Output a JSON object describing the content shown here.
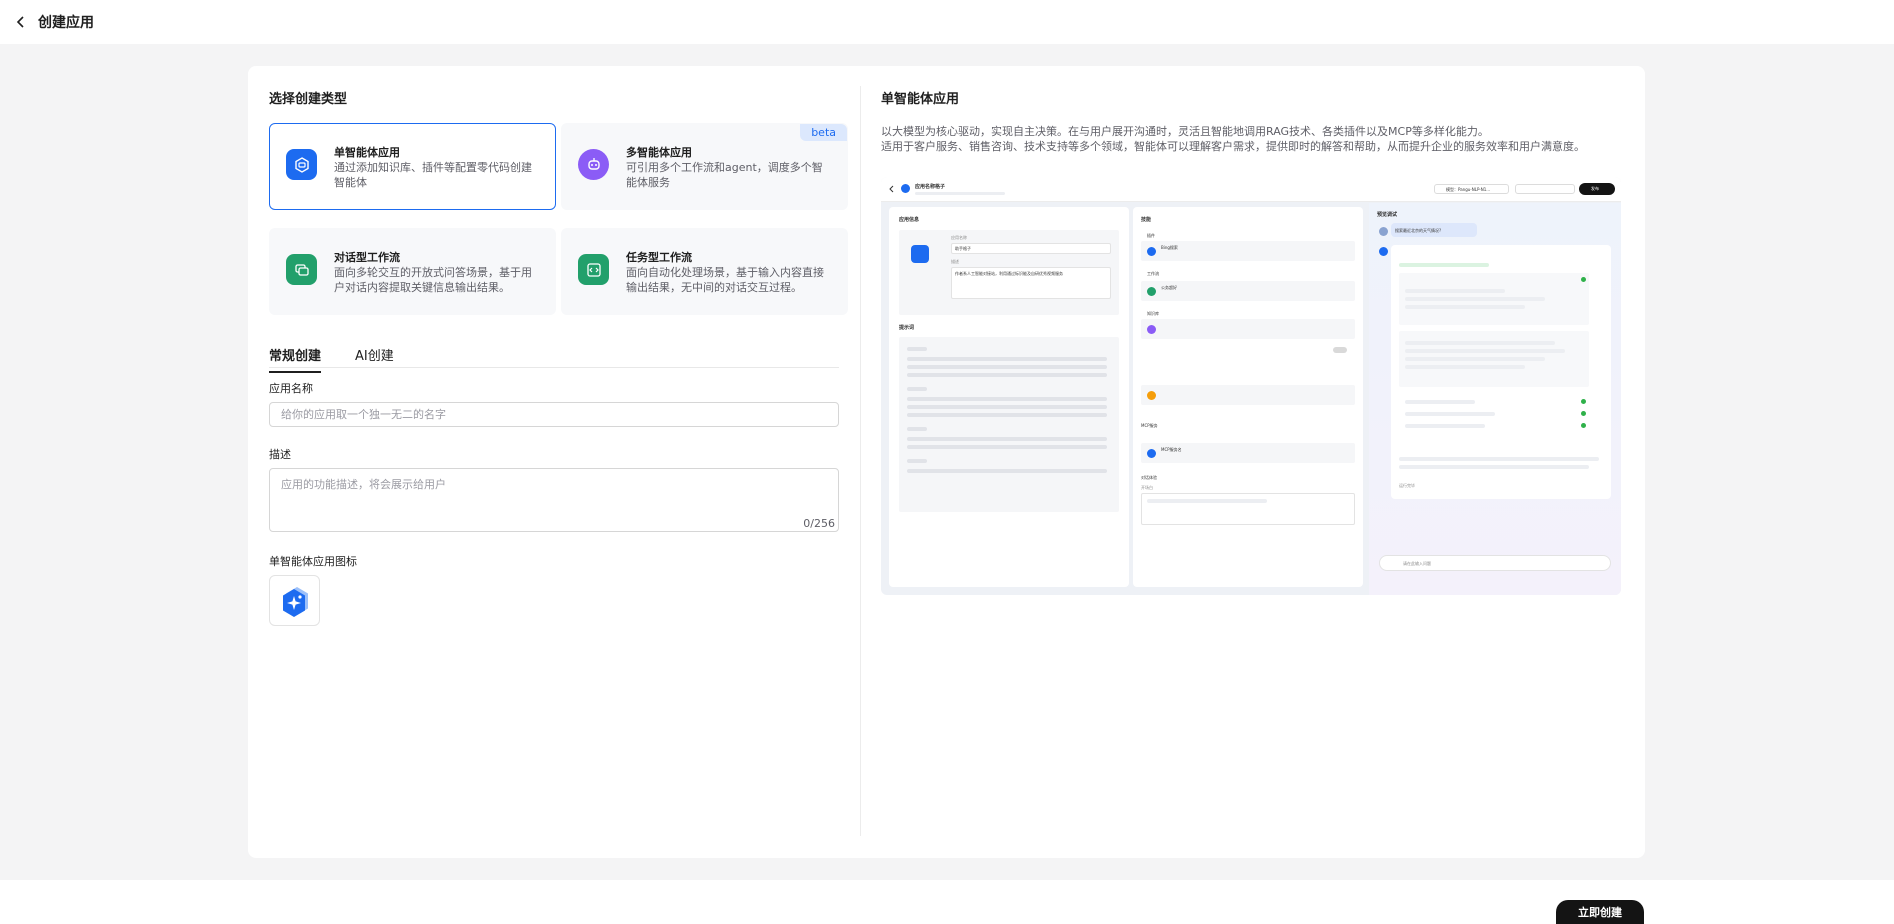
{
  "header": {
    "title": "创建应用"
  },
  "left": {
    "section_title": "选择创建类型",
    "types": [
      {
        "title": "单智能体应用",
        "desc": "通过添加知识库、插件等配置零代码创建智能体",
        "icon": "single-agent-icon",
        "color": "#1d6bf0",
        "selected": true
      },
      {
        "title": "多智能体应用",
        "desc": "可引用多个工作流和agent，调度多个智能体服务",
        "icon": "multi-agent-icon",
        "color": "#8b5cf6",
        "badge": "beta"
      },
      {
        "title": "对话型工作流",
        "desc": "面向多轮交互的开放式问答场景，基于用户对话内容提取关键信息输出结果。",
        "icon": "chat-workflow-icon",
        "color": "#22a06b"
      },
      {
        "title": "任务型工作流",
        "desc": "面向自动化处理场景，基于输入内容直接输出结果，无中间的对话交互过程。",
        "icon": "task-workflow-icon",
        "color": "#22a06b"
      }
    ],
    "tabs": [
      {
        "label": "常规创建",
        "active": true
      },
      {
        "label": "AI创建"
      }
    ],
    "name_label": "应用名称",
    "name_placeholder": "给你的应用取一个独一无二的名字",
    "desc_label": "描述",
    "desc_placeholder": "应用的功能描述，将会展示给用户",
    "desc_counter": "0/256",
    "icon_label": "单智能体应用图标"
  },
  "right": {
    "title": "单智能体应用",
    "desc_line1": "以大模型为核心驱动，实现自主决策。在与用户展开沟通时，灵活且智能地调用RAG技术、各类插件以及MCP等多样化能力。",
    "desc_line2": "适用于客户服务、销售咨询、技术支持等多个领域，智能体可以理解客户需求，提供即时的解答和帮助，从而提升企业的服务效率和用户满意度。",
    "preview": {
      "app_name": "应用名称格子",
      "model_label": "模型：Pangu-NLP-N1...",
      "publish": "发布",
      "col1_title": "应用信息",
      "app_name_label": "应用名称",
      "app_name_value": "助手格子",
      "desc_label": "描述",
      "desc_value": "作者系人工智能对接站，利用通过标识能及自研优秀视频服务",
      "prompt_title": "提示词",
      "col2_title": "技能",
      "plugins": "插件",
      "plugin_name": "Bing搜索",
      "workflow": "工作流",
      "workflow_name": "公务超好",
      "knowledge": "知识库",
      "mcp": "MCP服务",
      "mcp_name": "MCP服务名",
      "dialog": "对话体验",
      "opening": "开场白",
      "col3_title": "预览调试",
      "question": "搜索最近北京的天气情况?",
      "run_done": "运行完毕",
      "input_placeholder": "请在此输入问题"
    }
  },
  "footer": {
    "create_label": "立即创建"
  }
}
